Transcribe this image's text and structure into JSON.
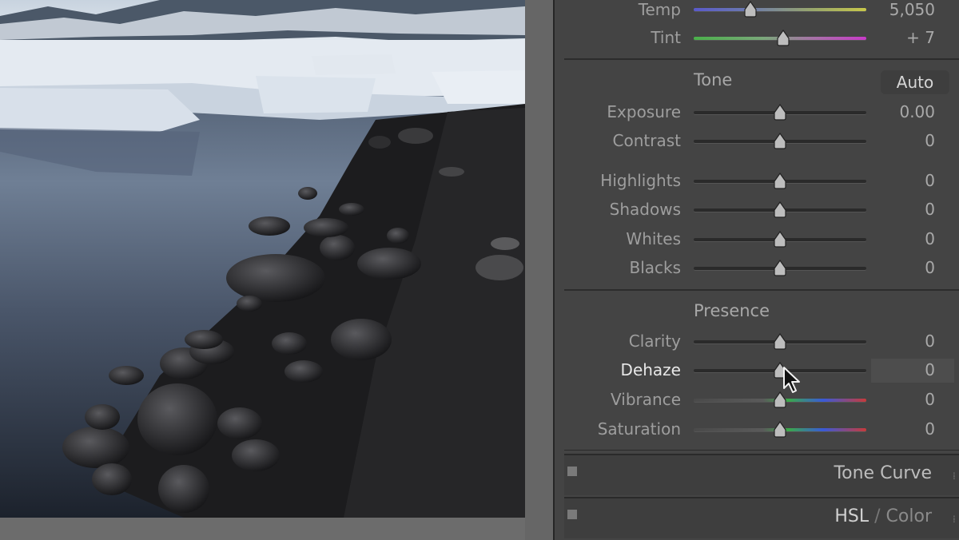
{
  "white_balance": {
    "temp": {
      "label": "Temp",
      "value": "5,050",
      "position": 0.33
    },
    "tint": {
      "label": "Tint",
      "value": "+ 7",
      "position": 0.52
    }
  },
  "tone": {
    "title": "Tone",
    "auto_label": "Auto",
    "sliders": [
      {
        "label": "Exposure",
        "value": "0.00",
        "position": 0.5
      },
      {
        "label": "Contrast",
        "value": "0",
        "position": 0.5
      },
      {
        "label": "Highlights",
        "value": "0",
        "position": 0.5
      },
      {
        "label": "Shadows",
        "value": "0",
        "position": 0.5
      },
      {
        "label": "Whites",
        "value": "0",
        "position": 0.5
      },
      {
        "label": "Blacks",
        "value": "0",
        "position": 0.5
      }
    ]
  },
  "presence": {
    "title": "Presence",
    "sliders": [
      {
        "label": "Clarity",
        "value": "0",
        "position": 0.5
      },
      {
        "label": "Dehaze",
        "value": "0",
        "position": 0.5,
        "active": true
      },
      {
        "label": "Vibrance",
        "value": "0",
        "position": 0.5
      },
      {
        "label": "Saturation",
        "value": "0",
        "position": 0.5
      }
    ]
  },
  "collapsed_panels": {
    "tone_curve": "Tone Curve",
    "hsl": "HSL",
    "hsl_sep": " / ",
    "color": "Color"
  },
  "icons": {
    "slider_thumb": "slider-thumb-icon",
    "cursor": "mouse-pointer-icon",
    "panel_toggle": "panel-toggle-icon"
  },
  "colors": {
    "panel_bg": "#444444",
    "text_dim": "#9e9e9e",
    "text_active": "#e8e8e8"
  }
}
